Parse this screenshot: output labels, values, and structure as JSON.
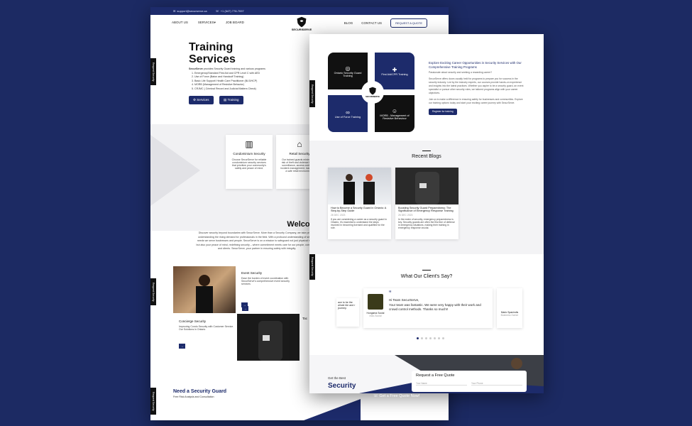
{
  "colors": {
    "navy": "#1d2b6b",
    "background": "#1c2a63"
  },
  "page1": {
    "topbar": {
      "email": "support@securserve.ca",
      "phone": "+1 (647) 778-7097"
    },
    "nav": {
      "about": "ABOUT US",
      "services": "SERVICES",
      "job_board": "JOB BOARD",
      "blog": "BLOG",
      "contact": "CONTACT US",
      "quote": "REQUEST A QUOTE"
    },
    "logo_text": "SECURISERVE",
    "side_tab": "Request Security",
    "hero": {
      "title_line1": "Training",
      "title_line2": "Services",
      "intro_bold": "SecurServe",
      "intro": " provides Security Guard training and various programs",
      "list": [
        "Emergency/Standard First Aid and CPR Level C with AED",
        "Use of Force (Baton and Handcuff Training)",
        "Basic Life Support/ Health Care Practitioner (BLS/HCP)",
        "MORB (Management of Resistive Behavior)",
        "CRJMC ( Criminal Record and Judicial Matters Check)"
      ],
      "btn_services": "Services",
      "btn_training": "Training"
    },
    "cards": [
      {
        "title": "Condominium Security",
        "text": "Choose SecurServe for reliable condominium security services that prioritize your community's safety and peace of mind."
      },
      {
        "title": "Retail Security",
        "text": "Our trained guards minimize the risk of theft and violence through surveillance, access control and incident management, maintaining a safe retail environment."
      }
    ],
    "welcome_title": "Welcome to SecurServe",
    "welcome_text": "Discover security beyond boundaries with SecurServe. More than a Security Company, we take pride in understanding the rising demand for professionals in the field. With a profound understanding of security needs we serve businesses and people. SecurServe is on a mission to safeguard not just physical spaces but also your peace of mind, redefining security – where commitment meets care for our people, community and clients. SecurServe, your partner in ensuring safety with integrity.",
    "event": {
      "title": "Event Security",
      "text": "Ease the burden of event coordination with SecurServe's comprehensive event security services"
    },
    "concierge": {
      "title": "Concierge Security",
      "text": "Improving Condo Security with Customer Service. Our Solutions in Ontario"
    },
    "tactical_title": "Tac",
    "arrow": "→",
    "need": {
      "title": "Need a Security Guard",
      "sub": "Free Risk Analysis and Consultation"
    }
  },
  "page2": {
    "quads": [
      "Ontario Security Guard Training",
      "First Aid/CPR Training",
      "Use of Force Training",
      "MORB - Management of Resistive Behaviour"
    ],
    "badge_text": "SECURISERVE",
    "explore": {
      "title": "Explore Exciting Career Opportunities in Security Services with Our Comprehensive Training Programs",
      "subtitle": "Passionate about security and seeking a rewarding career?",
      "text1": "SecurServe offers doors usually held for programs to prepare you for success in the security industry. Led by the industry experts, our courses provide hands-on experience and insights into the latest practices. Whether you aspire to be a security guard, an event specialist or pursue other security roles, we tailored programs align with your career objectives.",
      "text2": "Join us to make a difference in ensuring safety for businesses and communities. Explore our training options today and start your exciting career journey with SecurServe.",
      "button": "Register for training"
    },
    "recent_blogs": "Recent Blogs",
    "blogs": [
      {
        "title": "How to Become a Security Guard in Ontario: A Step-by-Step Guide",
        "date": "28 DEC 2023",
        "text": "If you are considering a career as a security guard in Ontario, it's essential to understand the steps involved in becoming licensed and qualified for the role."
      },
      {
        "title": "Boosting Security Guard Preparedness: The Significance of Emergency Response Training",
        "date": "26 DEC 2023",
        "text": "In the realm of security, emergency preparedness is key. Security guards are often the first line of defense in emergency situations, making their training in emergency response crucial."
      }
    ],
    "testimonials_title": "What Our Client's Say?",
    "testimonial_left": "ace to be the whole ble and r journey.",
    "testimonial": {
      "greeting": "Hi Team SecurServe,",
      "text": "Your team was fantastic. We were very happy with their work and crowd control methods. Thanks so much!!",
      "name": "Hungama Social",
      "role": "Indo-Social"
    },
    "testimonial_right": {
      "name": "Mario Spanindis",
      "role": "Business Owner"
    },
    "quote_mark": "“",
    "footer": {
      "get": "Get the Best",
      "security": "Security",
      "form_title": "Request a Free Quote",
      "f_name": "Your Name",
      "f_phone": "Your Phone",
      "cta": "Get a Free Quote Now!"
    }
  }
}
